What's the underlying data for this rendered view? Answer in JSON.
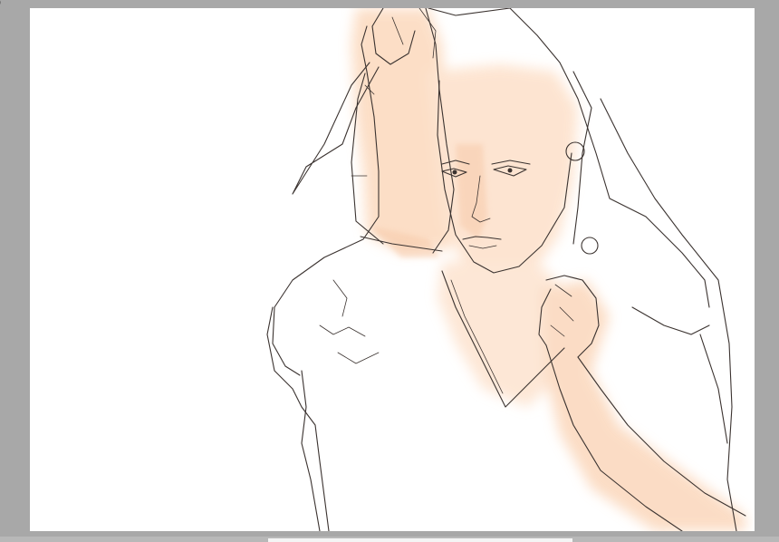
{
  "app": {
    "corner_glyph": ")"
  },
  "canvas": {
    "background": "#ffffff",
    "workspace_color": "#a8a8a8",
    "skin_tone": "#fde3cf",
    "line_color": "#3b3330"
  },
  "scrollbar": {
    "orientation": "horizontal",
    "thumb_color": "#f4f4f4"
  }
}
